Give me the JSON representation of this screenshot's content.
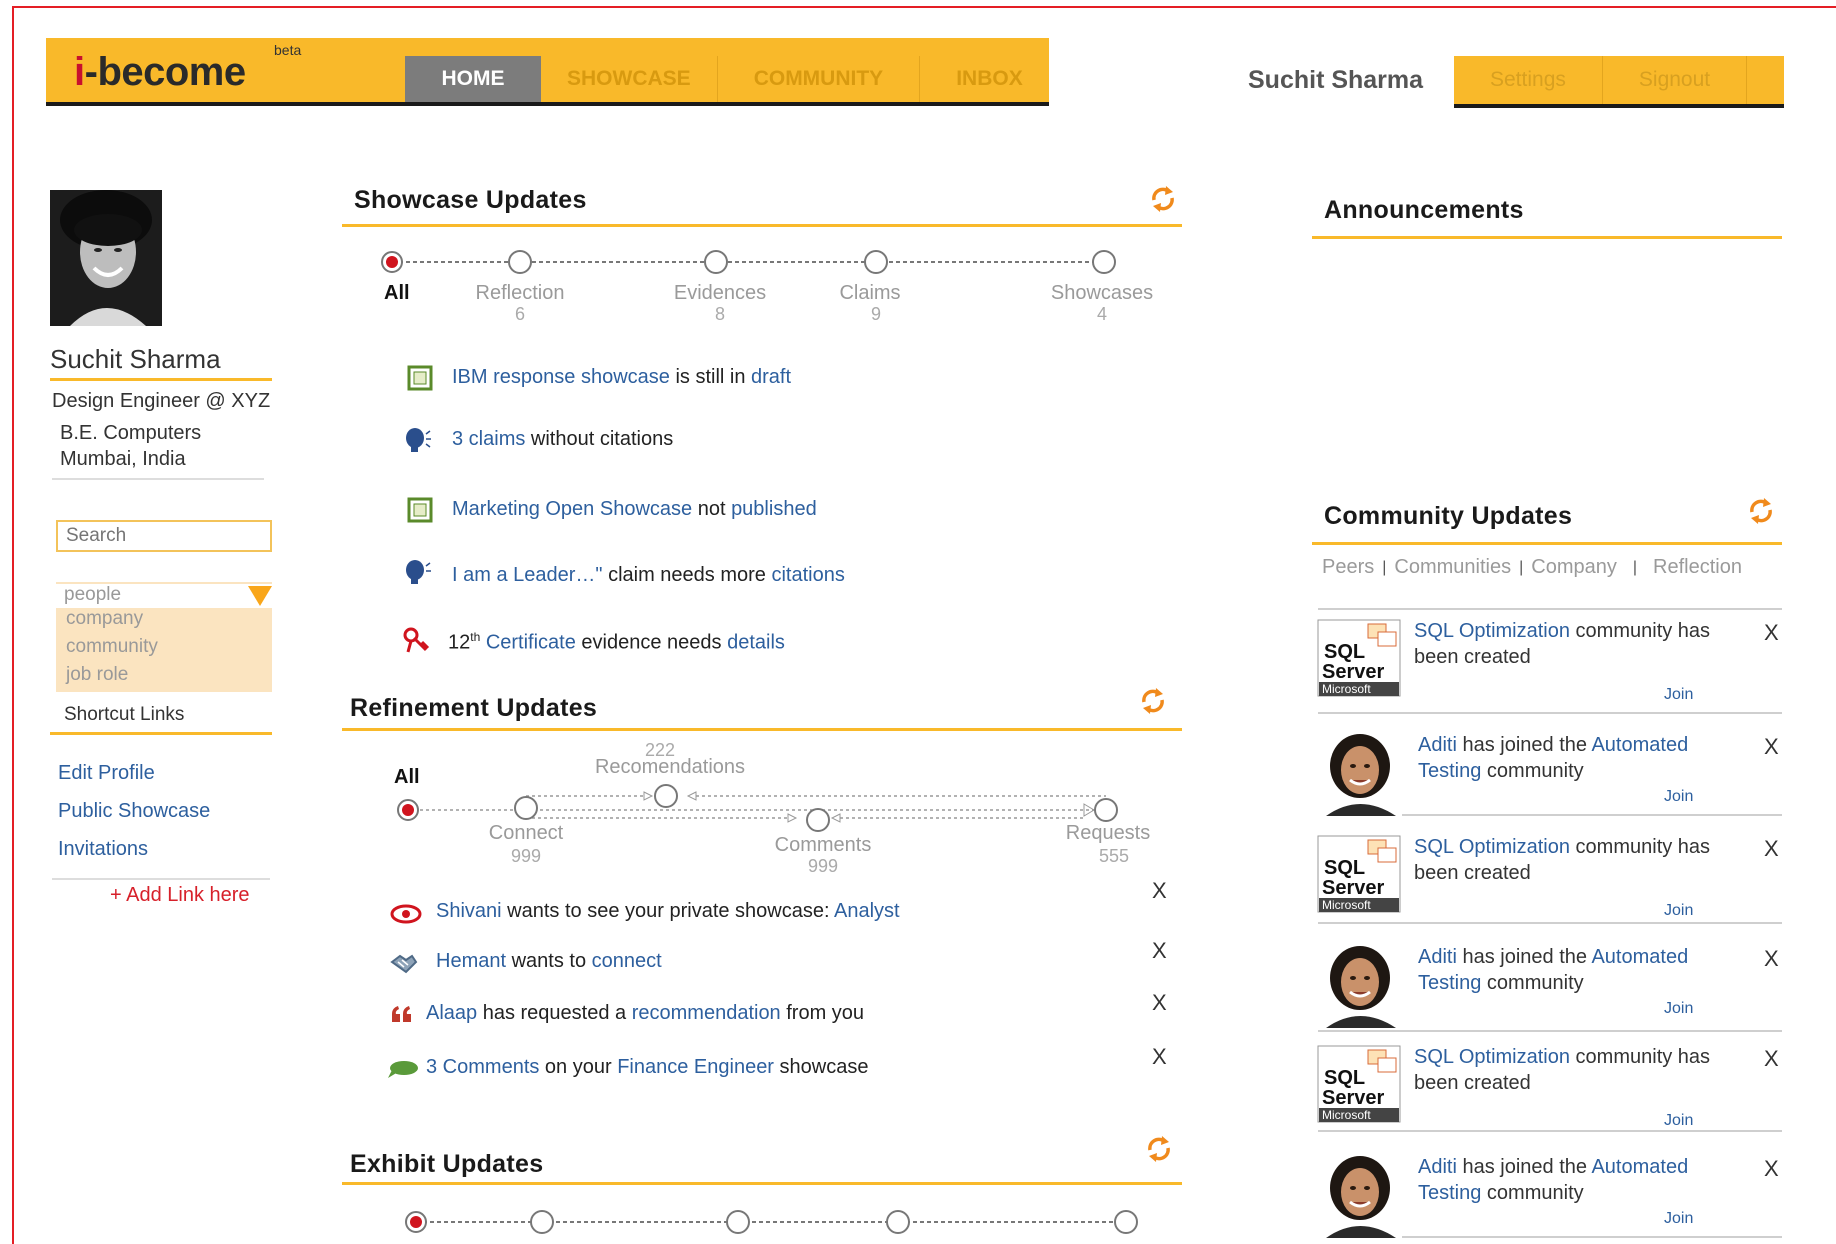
{
  "header": {
    "logo": "i-become",
    "beta": "beta",
    "nav": [
      "HOME",
      "SHOWCASE",
      "COMMUNITY",
      "INBOX"
    ],
    "user_name": "Suchit Sharma",
    "settings": "Settings",
    "signout": "Signout"
  },
  "profile": {
    "name": "Suchit Sharma",
    "title": "Design Engineer @ XYZ",
    "degree": "B.E. Computers",
    "location": "Mumbai, India"
  },
  "search": {
    "placeholder": "Search",
    "options": [
      "people",
      "company",
      "community",
      "job role"
    ]
  },
  "shortcuts": {
    "title": "Shortcut Links",
    "links": [
      "Edit Profile",
      "Public Showcase",
      "Invitations"
    ],
    "add": "+ Add Link here"
  },
  "showcase": {
    "title": "Showcase Updates",
    "filters": [
      {
        "label": "All",
        "count": ""
      },
      {
        "label": "Reflection",
        "count": "6"
      },
      {
        "label": "Evidences",
        "count": "8"
      },
      {
        "label": "Claims",
        "count": "9"
      },
      {
        "label": "Showcases",
        "count": "4"
      }
    ],
    "items": [
      {
        "a": "IBM response showcase",
        "b": " is still in ",
        "c": "draft",
        "d": ""
      },
      {
        "a": "3 claims",
        "b": " without citations",
        "c": "",
        "d": ""
      },
      {
        "a": "Marketing Open Showcase",
        "b": " not ",
        "c": "published",
        "d": ""
      },
      {
        "a": "I am a Leader…\"",
        "b": " claim needs more ",
        "c": "citations",
        "d": ""
      },
      {
        "a": "Certificate",
        "b": " evidence needs ",
        "c": "details",
        "d": "12",
        "sup": "th"
      }
    ]
  },
  "refinement": {
    "title": "Refinement Updates",
    "all": "All",
    "connect": {
      "label": "Connect",
      "count": "999"
    },
    "recommendations": {
      "label": "Recomendations",
      "count": "222"
    },
    "comments": {
      "label": "Comments",
      "count": "999"
    },
    "requests": {
      "label": "Requests",
      "count": "555"
    },
    "items": [
      {
        "a": "Shivani",
        "b": " wants to see your private showcase: ",
        "c": "Analyst",
        "d": ""
      },
      {
        "a": "Hemant",
        "b": " wants to ",
        "c": "connect",
        "d": ""
      },
      {
        "a": "Alaap",
        "b": " has requested a ",
        "c": "recommendation",
        "d": " from you"
      },
      {
        "a": "3 Comments",
        "b": " on your ",
        "c": "Finance Engineer",
        "d": " showcase"
      }
    ],
    "close": "X"
  },
  "exhibit": {
    "title": "Exhibit Updates"
  },
  "announcements": {
    "title": "Announcements"
  },
  "community": {
    "title": "Community Updates",
    "tabs": [
      "Peers",
      "Communities",
      "Company",
      "Reflection"
    ],
    "join": "Join",
    "close": "X",
    "sql_logo": {
      "line1": "SQL",
      "line2": "Server",
      "line3": "Microsoft"
    },
    "items": [
      {
        "type": "sql",
        "l1a": "SQL Optimization",
        "l1b": " community has",
        "l2a": "been created",
        "l2b": ""
      },
      {
        "type": "person",
        "l1a": "Aditi",
        "l1b": " has joined the ",
        "l1c": "Automated",
        "l2a": "Testing",
        "l2b": " community"
      },
      {
        "type": "sql",
        "l1a": "SQL Optimization",
        "l1b": " community has",
        "l2a": "been created",
        "l2b": ""
      },
      {
        "type": "person",
        "l1a": "Aditi",
        "l1b": " has joined the ",
        "l1c": "Automated",
        "l2a": "Testing",
        "l2b": " community"
      },
      {
        "type": "sql",
        "l1a": "SQL Optimization",
        "l1b": " community has",
        "l2a": "been created",
        "l2b": ""
      },
      {
        "type": "person",
        "l1a": "Aditi",
        "l1b": " has joined the ",
        "l1c": "Automated",
        "l2a": "Testing",
        "l2b": " community"
      }
    ]
  },
  "colors": {
    "accent": "#f9b92a",
    "link": "#2d5f9e",
    "frame": "#e41e25",
    "active_dot": "#d0141e"
  }
}
